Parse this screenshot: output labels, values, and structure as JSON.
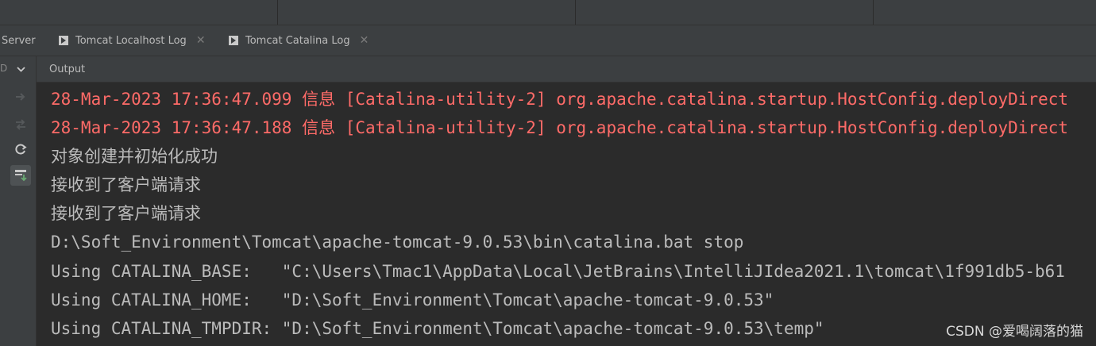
{
  "tabs": [
    {
      "label": "Server",
      "has_icon": false,
      "closable": false
    },
    {
      "label": "Tomcat Localhost Log",
      "has_icon": true,
      "closable": true
    },
    {
      "label": "Tomcat Catalina Log",
      "has_icon": true,
      "closable": true
    }
  ],
  "gutter": {
    "header_text": "D",
    "chevron_icon": "chevron-down-icon",
    "buttons": [
      {
        "icon": "rerun-icon",
        "enabled": false
      },
      {
        "icon": "update-icon",
        "enabled": false
      },
      {
        "icon": "refresh-icon",
        "enabled": true
      },
      {
        "icon": "scroll-to-end-icon",
        "enabled": true
      }
    ]
  },
  "output": {
    "header_label": "Output",
    "lines": [
      {
        "text": "28-Mar-2023 17:36:47.099 信息 [Catalina-utility-2] org.apache.catalina.startup.HostConfig.deployDirect",
        "type": "error"
      },
      {
        "text": "28-Mar-2023 17:36:47.188 信息 [Catalina-utility-2] org.apache.catalina.startup.HostConfig.deployDirect",
        "type": "error"
      },
      {
        "text": "对象创建并初始化成功",
        "type": "normal"
      },
      {
        "text": "接收到了客户端请求",
        "type": "normal"
      },
      {
        "text": "接收到了客户端请求",
        "type": "normal"
      },
      {
        "text": "D:\\Soft_Environment\\Tomcat\\apache-tomcat-9.0.53\\bin\\catalina.bat stop",
        "type": "normal"
      },
      {
        "text": "Using CATALINA_BASE:   \"C:\\Users\\Tmac1\\AppData\\Local\\JetBrains\\IntelliJIdea2021.1\\tomcat\\1f991db5-b61",
        "type": "normal"
      },
      {
        "text": "Using CATALINA_HOME:   \"D:\\Soft_Environment\\Tomcat\\apache-tomcat-9.0.53\"",
        "type": "normal"
      },
      {
        "text": "Using CATALINA_TMPDIR: \"D:\\Soft_Environment\\Tomcat\\apache-tomcat-9.0.53\\temp\"",
        "type": "normal"
      }
    ]
  },
  "watermark": "CSDN @爱喝阔落的猫",
  "colors": {
    "error": "#ff6b68",
    "normal": "#bbbbbb",
    "background": "#2b2b2b",
    "panel": "#3c3f41"
  }
}
